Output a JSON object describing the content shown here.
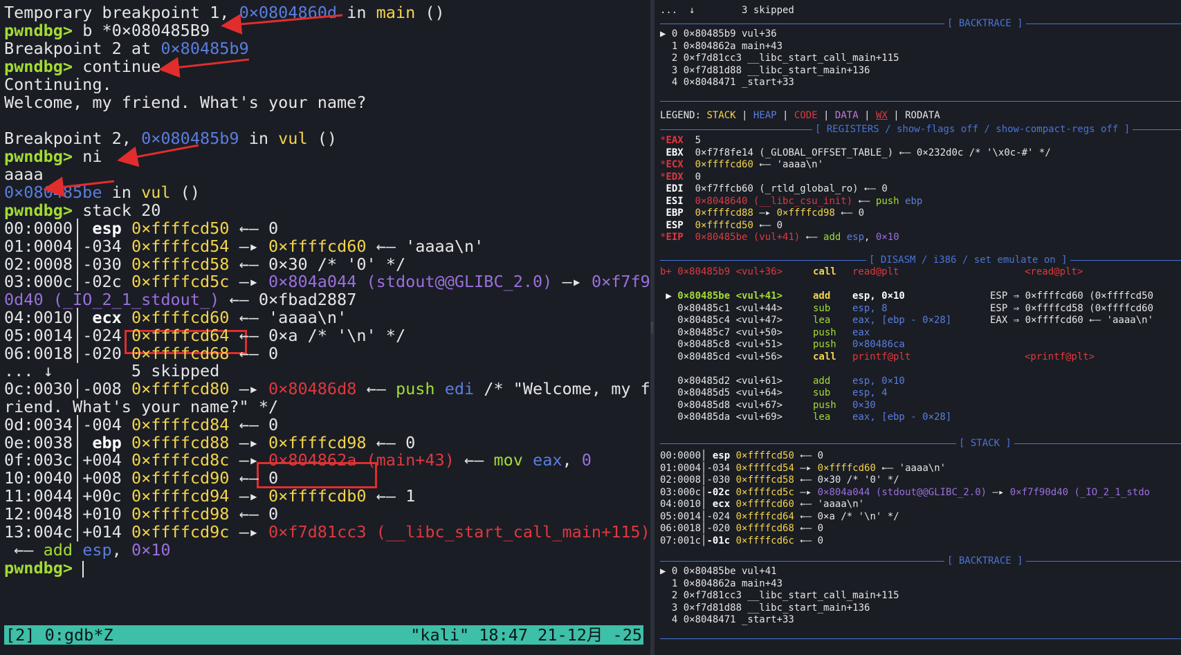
{
  "left": {
    "l1": {
      "a": "Temporary breakpoint 1, ",
      "addr": "0×0804860d",
      "b": " in ",
      "fn": "main",
      "c": " ()"
    },
    "l2": {
      "prompt": "pwndbg>",
      "cmd": " b *0×080485B9"
    },
    "l3": {
      "a": "Breakpoint 2 at ",
      "addr": "0×80485b9"
    },
    "l4": {
      "prompt": "pwndbg>",
      "cmd": " continue"
    },
    "l5": "Continuing.",
    "l6": "Welcome, my friend. What's your name?",
    "l8": {
      "a": "Breakpoint 2, ",
      "addr": "0×080485b9",
      "b": " in ",
      "fn": "vul",
      "c": " ()"
    },
    "l9": {
      "prompt": "pwndbg>",
      "cmd": " ni"
    },
    "l10": "aaaa",
    "l11": {
      "addr": "0×080485be",
      "b": " in ",
      "fn": "vul",
      "c": " ()"
    },
    "l12": {
      "prompt": "pwndbg>",
      "cmd": " stack 20"
    },
    "stack": [
      {
        "idx": "00:0000",
        "off": " esp",
        "addr": "0×ffffcd50",
        "rest1": " ←— 0"
      },
      {
        "idx": "01:0004",
        "off": "-034",
        "addr": "0×ffffcd54",
        "rest1": " —▸ ",
        "val": "0×ffffcd60",
        "rest2": " ←— 'aaaa\\n'"
      },
      {
        "idx": "02:0008",
        "off": "-030",
        "addr": "0×ffffcd58",
        "rest1": " ←— 0×30 /* '0' */"
      },
      {
        "idx": "03:000c",
        "off": "-02c",
        "addr": "0×ffffcd5c",
        "rest1": " —▸ ",
        "val": "0×804a044 (stdout@@GLIBC_2.0)",
        "rest2": " —▸ ",
        "val2": "0×f7f9"
      },
      {
        "cont": "0d40 (_IO_2_1_stdout_)",
        "rest": " ←— 0×fbad2887"
      },
      {
        "idx": "04:0010",
        "off": " ecx",
        "addr": "0×ffffcd60",
        "rest1": " ←— 'aaaa\\n'"
      },
      {
        "idx": "05:0014",
        "off": "-024",
        "addr": "0×ffffcd64",
        "rest1": " ←— 0×a /* '\\n' */"
      },
      {
        "idx": "06:0018",
        "off": "-020",
        "addr": "0×ffffcd68",
        "rest1": " ←— 0"
      },
      {
        "skip": "... ↓        5 skipped"
      },
      {
        "idx": "0c:0030",
        "off": "-008",
        "addr": "0×ffffcd80",
        "rest1": " —▸ ",
        "val": "0×80486d8",
        "rest2": " ←— ",
        "ins": "push",
        "reg": " edi",
        "cmt": " /* \"Welcome, my f"
      },
      {
        "cont2": "riend. What's your name?\" */"
      },
      {
        "idx": "0d:0034",
        "off": "-004",
        "addr": "0×ffffcd84",
        "rest1": " ←— 0"
      },
      {
        "idx": "0e:0038",
        "off": " ebp",
        "addr": "0×ffffcd88",
        "rest1": " —▸ ",
        "val": "0×ffffcd98",
        "rest2": " ←— 0"
      },
      {
        "idx": "0f:003c",
        "off": "+004",
        "addr": "0×ffffcd8c",
        "rest1": " —▸ ",
        "val": "0×804862a (main+43)",
        "rest2": " ←— ",
        "ins": "mov",
        "reg": " eax",
        "cmt": ", ",
        "num": "0"
      },
      {
        "idx": "10:0040",
        "off": "+008",
        "addr": "0×ffffcd90",
        "rest1": " ←— 0"
      },
      {
        "idx": "11:0044",
        "off": "+00c",
        "addr": "0×ffffcd94",
        "rest1": " —▸ ",
        "val": "0×ffffcdb0",
        "rest2": " ←— 1"
      },
      {
        "idx": "12:0048",
        "off": "+010",
        "addr": "0×ffffcd98",
        "rest1": " ←— 0"
      },
      {
        "idx": "13:004c",
        "off": "+014",
        "addr": "0×ffffcd9c",
        "rest1": " —▸ ",
        "val": "0×f7d81cc3 (__libc_start_call_main+115)"
      }
    ],
    "l_last": {
      "a": " ←— ",
      "ins": "add",
      "reg": " esp",
      "b": ", ",
      "num": "0×10"
    },
    "final_prompt": "pwndbg>",
    "status": {
      "left": "[2] 0:gdb*Z",
      "right": "\"kali\" 18:47 21-12月 -25"
    }
  },
  "right": {
    "top_skip": "...  ↓        3 skipped",
    "backtrace_title": "[ BACKTRACE ]",
    "bt1": [
      "▶ 0 0×80485b9 vul+36",
      "  1 0×804862a main+43",
      "  2 0×f7d81cc3 __libc_start_call_main+115",
      "  3 0×f7d81d88 __libc_start_main+136",
      "  4 0×8048471 _start+33"
    ],
    "legend": {
      "label": "LEGEND: ",
      "stack": "STACK",
      "heap": "HEAP",
      "code": "CODE",
      "data": "DATA",
      "wx": "WX",
      "rodata": "RODATA",
      "sep": " | "
    },
    "registers_title": "[ REGISTERS / show-flags off / show-compact-regs off ]",
    "regs": [
      {
        "star": "*",
        "name": "EAX",
        "val": "5"
      },
      {
        "star": " ",
        "name": "EBX",
        "val": "0×f7f8fe14 (_GLOBAL_OFFSET_TABLE_) ←— 0×232d0c /* '\\x0c-#' */"
      },
      {
        "star": "*",
        "name": "ECX",
        "val1": "0×ffffcd60",
        "val": " ←— 'aaaa\\n'"
      },
      {
        "star": "*",
        "name": "EDX",
        "val": "0"
      },
      {
        "star": " ",
        "name": "EDI",
        "val": "0×f7ffcb60 (_rtld_global_ro) ←— 0"
      },
      {
        "star": " ",
        "name": "ESI",
        "val1": "0×8048640 (__libc_csu_init)",
        "val": " ←— ",
        "ins": "push",
        "reg": " ebp"
      },
      {
        "star": " ",
        "name": "EBP",
        "val1": "0×ffffcd88",
        "val": " —▸ ",
        "val2": "0×ffffcd98",
        "val3": " ←— 0"
      },
      {
        "star": " ",
        "name": "ESP",
        "val1": "0×ffffcd50",
        "val": " ←— 0"
      },
      {
        "star": "*",
        "name": "EIP",
        "val1": "0×80485be (vul+41)",
        "val": " ←— ",
        "ins": "add",
        "reg": " esp",
        "cmt": ", ",
        "num": "0×10"
      }
    ],
    "disasm_title": "[ DISASM / i386 / set emulate on ]",
    "disasm": [
      {
        "pre": "b+ ",
        "addr": "0×80485b9",
        "sym": " <vul+36>",
        "mn": "call",
        "op": "read@plt",
        "cmt": "<read@plt>",
        "bp": true
      },
      {
        "gap": true
      },
      {
        "pre": " ▶ ",
        "addr": "0×80485be",
        "sym": " <vul+41>",
        "mn": "add",
        "op": "esp, 0×10",
        "cmt": "ESP ⇒ 0×ffffcd60 (0×ffffcd50",
        "cur": true
      },
      {
        "pre": "   ",
        "addr": "0×80485c1",
        "sym": " <vul+44>",
        "mn": "sub",
        "op": "esp, 8",
        "cmt": "ESP ⇒ 0×ffffcd58 (0×ffffcd60"
      },
      {
        "pre": "   ",
        "addr": "0×80485c4",
        "sym": " <vul+47>",
        "mn": "lea",
        "op": "eax, [ebp - 0×28]",
        "cmt": "EAX ⇒ 0×ffffcd60 ←— 'aaaa\\n'"
      },
      {
        "pre": "   ",
        "addr": "0×80485c7",
        "sym": " <vul+50>",
        "mn": "push",
        "op": "eax"
      },
      {
        "pre": "   ",
        "addr": "0×80485c8",
        "sym": " <vul+51>",
        "mn": "push",
        "op": "0×80486ca"
      },
      {
        "pre": "   ",
        "addr": "0×80485cd",
        "sym": " <vul+56>",
        "mn": "call",
        "op": "printf@plt",
        "cmt": "<printf@plt>"
      },
      {
        "gap": true
      },
      {
        "pre": "   ",
        "addr": "0×80485d2",
        "sym": " <vul+61>",
        "mn": "add",
        "op": "esp, 0×10"
      },
      {
        "pre": "   ",
        "addr": "0×80485d5",
        "sym": " <vul+64>",
        "mn": "sub",
        "op": "esp, 4"
      },
      {
        "pre": "   ",
        "addr": "0×80485d8",
        "sym": " <vul+67>",
        "mn": "push",
        "op": "0×30"
      },
      {
        "pre": "   ",
        "addr": "0×80485da",
        "sym": " <vul+69>",
        "mn": "lea",
        "op": "eax, [ebp - 0×28]"
      }
    ],
    "stack_title": "[ STACK ]",
    "stack": [
      {
        "idx": "00:0000",
        "off": " esp",
        "addr": "0×ffffcd50",
        "rest": " ←— 0"
      },
      {
        "idx": "01:0004",
        "off": "-034",
        "addr": "0×ffffcd54",
        "rest": " —▸ ",
        "val": "0×ffffcd60",
        "rest2": " ←— 'aaaa\\n'"
      },
      {
        "idx": "02:0008",
        "off": "-030",
        "addr": "0×ffffcd58",
        "rest": " ←— 0×30 /* '0' */"
      },
      {
        "idx": "03:000c",
        "off": "-02c",
        "addr": "0×ffffcd5c",
        "rest": " —▸ ",
        "val": "0×804a044 (stdout@@GLIBC_2.0)",
        "rest2": " —▸ ",
        "val2": "0×f7f90d40 (_IO_2_1_stdo"
      },
      {
        "idx": "04:0010",
        "off": " ecx",
        "addr": "0×ffffcd60",
        "rest": " ←— 'aaaa\\n'"
      },
      {
        "idx": "05:0014",
        "off": "-024",
        "addr": "0×ffffcd64",
        "rest": " ←— 0×a /* '\\n' */"
      },
      {
        "idx": "06:0018",
        "off": "-020",
        "addr": "0×ffffcd68",
        "rest": " ←— 0"
      },
      {
        "idx": "07:001c",
        "off": "-01c",
        "addr": "0×ffffcd6c",
        "rest": " ←— 0"
      }
    ],
    "backtrace2_title": "[ BACKTRACE ]",
    "bt2": [
      "▶ 0 0×80485be vul+41",
      "  1 0×804862a main+43",
      "  2 0×f7d81cc3 __libc_start_call_main+115",
      "  3 0×f7d81d88 __libc_start_main+136",
      "  4 0×8048471 _start+33"
    ]
  },
  "colors": {
    "accent_green": "#a3dc34",
    "accent_blue": "#5b7dde",
    "accent_red": "#e0383e",
    "status_bar": "#3dbfa8",
    "highlight_box": "#e22d2d"
  }
}
